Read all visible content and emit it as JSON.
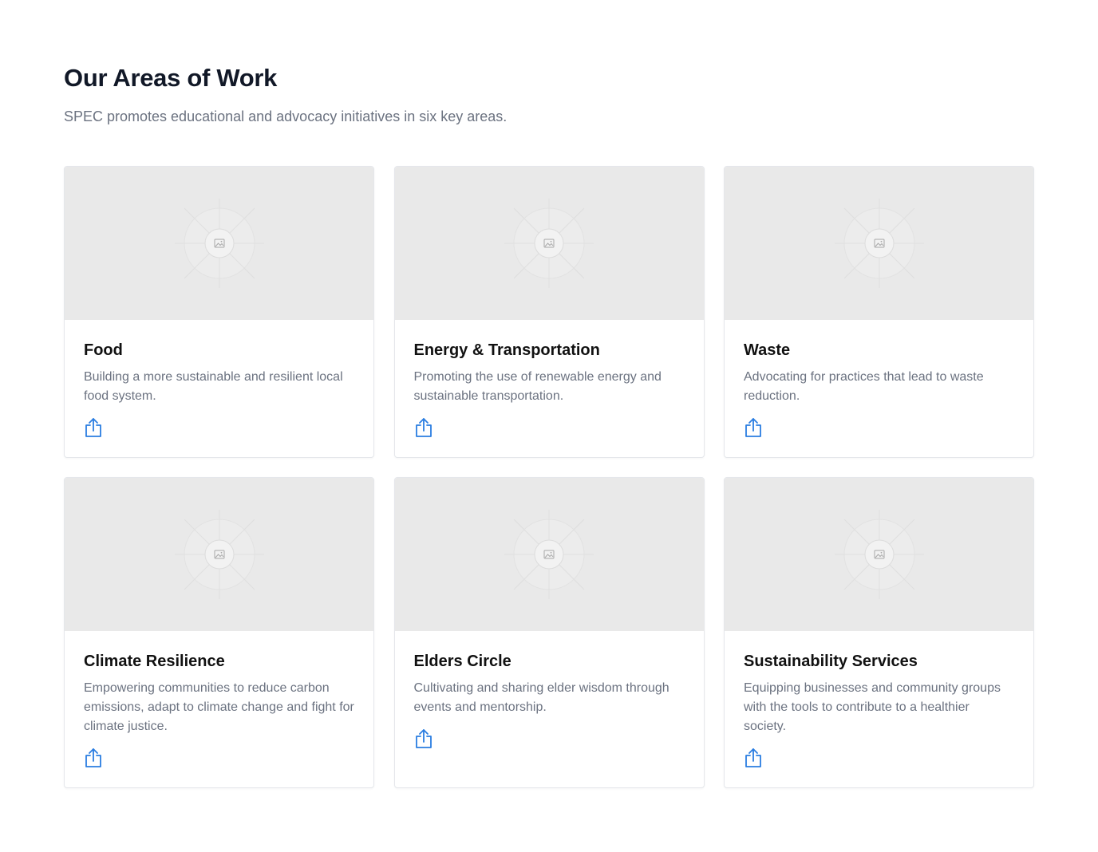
{
  "section": {
    "title": "Our Areas of Work",
    "subtitle": "SPEC promotes educational and advocacy initiatives in six key areas."
  },
  "cards": [
    {
      "title": "Food",
      "description": "Building a more sustainable and resilient local food system.",
      "image_icon": "image-placeholder-icon",
      "action_icon": "share-icon"
    },
    {
      "title": "Energy & Transportation",
      "description": "Promoting the use of renewable energy and sustainable transportation.",
      "image_icon": "image-placeholder-icon",
      "action_icon": "share-icon"
    },
    {
      "title": "Waste",
      "description": "Advocating for practices that lead to waste reduction.",
      "image_icon": "image-placeholder-icon",
      "action_icon": "share-icon"
    },
    {
      "title": "Climate Resilience",
      "description": "Empowering communities to reduce carbon emissions, adapt to climate change and fight for climate justice.",
      "image_icon": "image-placeholder-icon",
      "action_icon": "share-icon"
    },
    {
      "title": "Elders Circle",
      "description": "Cultivating and sharing elder wisdom through events and mentorship.",
      "image_icon": "image-placeholder-icon",
      "action_icon": "share-icon"
    },
    {
      "title": "Sustainability Services",
      "description": "Equipping businesses and community groups with the tools to contribute to a healthier society.",
      "image_icon": "image-placeholder-icon",
      "action_icon": "share-icon"
    }
  ],
  "colors": {
    "heading": "#111827",
    "muted_text": "#6b7280",
    "placeholder_bg": "#e9e9e9",
    "accent_icon": "#2a7de1",
    "card_border": "#e5e7eb"
  }
}
